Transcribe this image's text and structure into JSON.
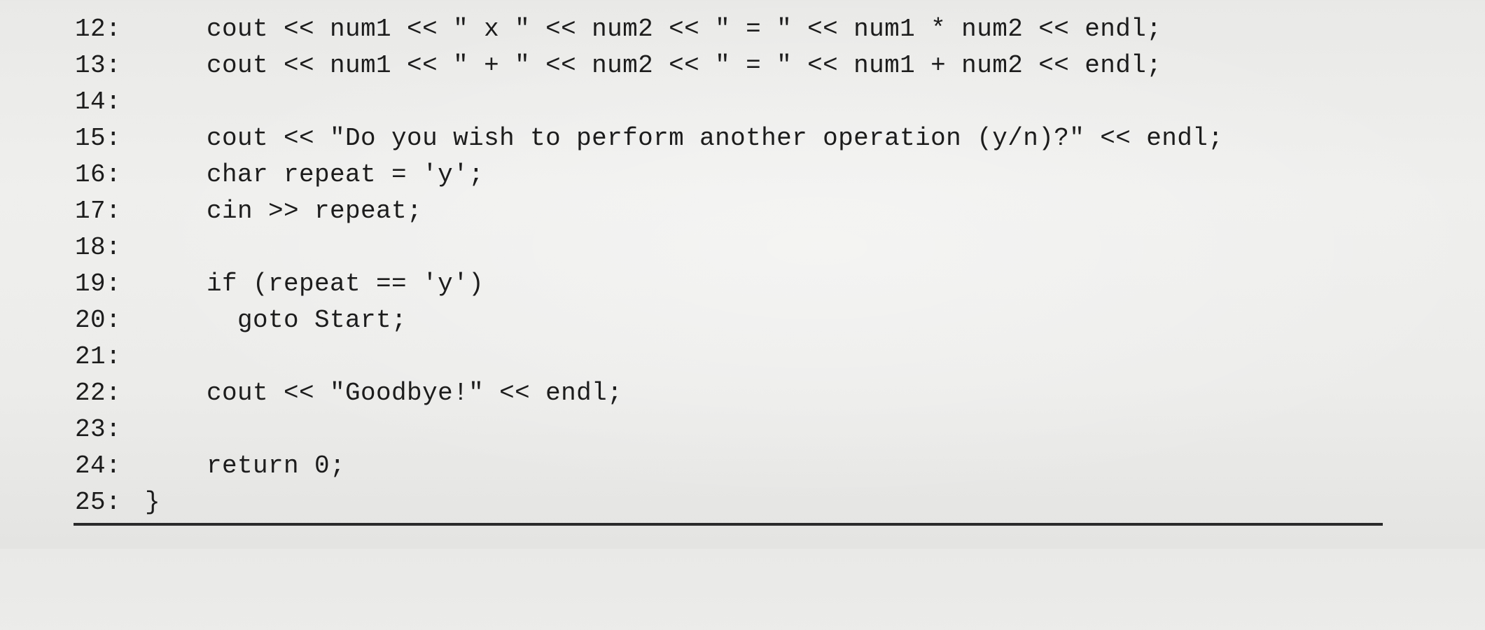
{
  "code_listing": {
    "lines": [
      {
        "number": "12:",
        "code": "    cout << num1 << \" x \" << num2 << \" = \" << num1 * num2 << endl;"
      },
      {
        "number": "13:",
        "code": "    cout << num1 << \" + \" << num2 << \" = \" << num1 + num2 << endl;"
      },
      {
        "number": "14:",
        "code": ""
      },
      {
        "number": "15:",
        "code": "    cout << \"Do you wish to perform another operation (y/n)?\" << endl;"
      },
      {
        "number": "16:",
        "code": "    char repeat = 'y';"
      },
      {
        "number": "17:",
        "code": "    cin >> repeat;"
      },
      {
        "number": "18:",
        "code": ""
      },
      {
        "number": "19:",
        "code": "    if (repeat == 'y')"
      },
      {
        "number": "20:",
        "code": "      goto Start;"
      },
      {
        "number": "21:",
        "code": ""
      },
      {
        "number": "22:",
        "code": "    cout << \"Goodbye!\" << endl;"
      },
      {
        "number": "23:",
        "code": ""
      },
      {
        "number": "24:",
        "code": "    return 0;"
      },
      {
        "number": "25:",
        "code": "}"
      }
    ]
  }
}
